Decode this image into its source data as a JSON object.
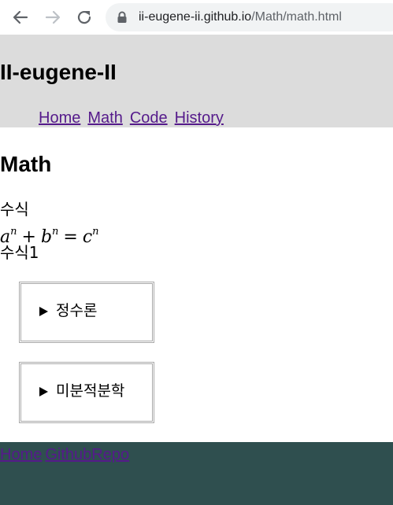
{
  "browser": {
    "url_host": "ii-eugene-ii.github.io",
    "url_path": "/Math/math.html"
  },
  "header": {
    "title": "II-eugene-II",
    "nav": [
      "Home",
      "Math",
      "Code",
      "History"
    ]
  },
  "main": {
    "title": "Math",
    "formula_label": "수식",
    "formula_label_2": "수식1",
    "sections": [
      "정수론",
      "미분적분학"
    ]
  },
  "footer": {
    "links": [
      "Home",
      "GithubRepo"
    ]
  }
}
